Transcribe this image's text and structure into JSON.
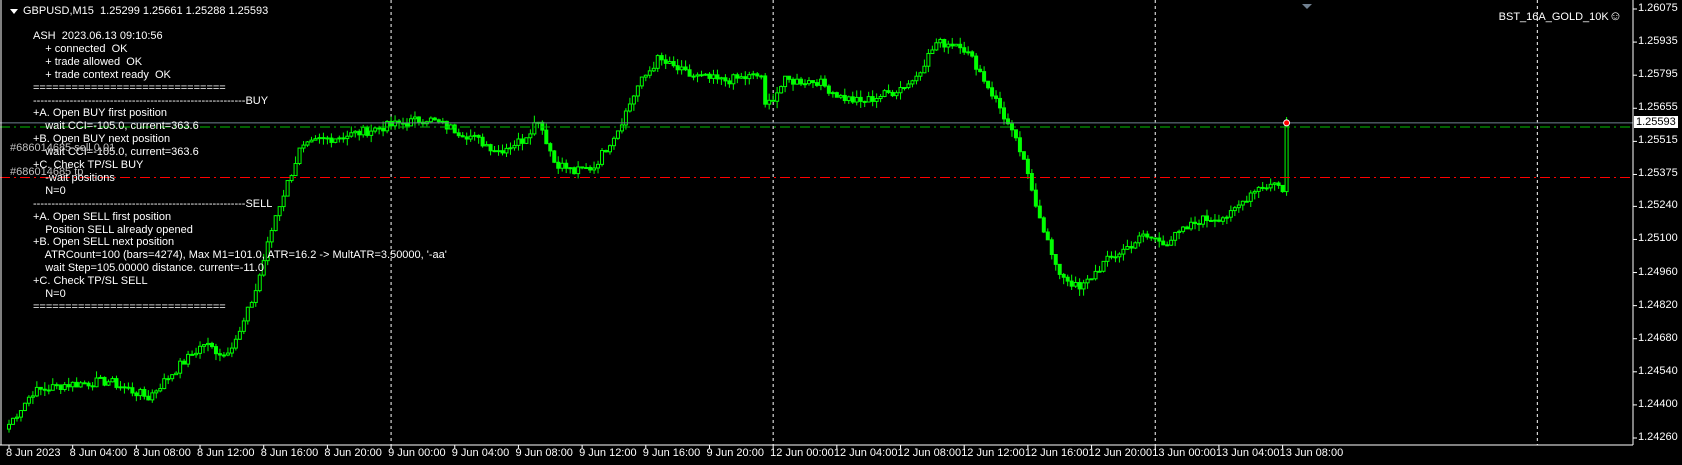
{
  "header": {
    "symbol": "GBPUSD,M15",
    "ohlc": "1.25299 1.25661 1.25288 1.25593"
  },
  "expert": {
    "name": "BST_16A_GOLD_10K",
    "icon": "smiley-icon"
  },
  "info_lines": [
    "ASH  2023.06.13 09:10:56",
    "    + connected  OK",
    "    + trade allowed  OK",
    "    + trade context ready  OK",
    "==============================",
    "----------------------------------------------------------BUY",
    "+A. Open BUY first position",
    "    wait CCI=-105.0, current=363.6",
    "+B. Open BUY next position",
    "    wait CCI=-105.0, current=363.6",
    "+C. Check TP/SL BUY",
    "    -wait positions",
    "    N=0",
    "----------------------------------------------------------SELL",
    "+A. Open SELL first position",
    "    Position SELL already opened",
    "+B. Open SELL next position",
    "    ATRCount=100 (bars=4274), Max M1=101.0, ATR=16.2 -> MultATR=3.50000, '-aa'",
    "    wait Step=105.00000 distance. current=-11.0",
    "+C. Check TP/SL SELL",
    "    N=0",
    "=============================="
  ],
  "orders": {
    "open_label": "#686014685 sell 0.01",
    "open_price": 1.2558,
    "tp_label": "#686014685 tp",
    "tp_price": 1.25362
  },
  "current_price": {
    "value": 1.25593,
    "label": "1.25593"
  },
  "price_axis": {
    "labels": [
      "1.26075",
      "1.25935",
      "1.25795",
      "1.25655",
      "1.25515",
      "1.25375",
      "1.25240",
      "1.25100",
      "1.24960",
      "1.24820",
      "1.24680",
      "1.24540",
      "1.24400",
      "1.24260"
    ],
    "max": 1.26075,
    "min": 1.2426
  },
  "time_axis": {
    "labels": [
      "8 Jun 2023",
      "8 Jun 04:00",
      "8 Jun 08:00",
      "8 Jun 12:00",
      "8 Jun 16:00",
      "8 Jun 20:00",
      "9 Jun 00:00",
      "9 Jun 04:00",
      "9 Jun 08:00",
      "9 Jun 12:00",
      "9 Jun 16:00",
      "9 Jun 20:00",
      "12 Jun 00:00",
      "12 Jun 04:00",
      "12 Jun 08:00",
      "12 Jun 12:00",
      "12 Jun 16:00",
      "12 Jun 20:00",
      "13 Jun 00:00",
      "13 Jun 04:00",
      "13 Jun 08:00"
    ],
    "bars_per_label": 16
  },
  "separators_bars": [
    96,
    192,
    288,
    384
  ],
  "price_path": [
    [
      0,
      1.24318
    ],
    [
      6,
      1.24455
    ],
    [
      14,
      1.24486
    ],
    [
      25,
      1.245
    ],
    [
      35,
      1.24432
    ],
    [
      43,
      1.24568
    ],
    [
      49,
      1.24659
    ],
    [
      54,
      1.24613
    ],
    [
      58,
      1.24704
    ],
    [
      62,
      1.24886
    ],
    [
      67,
      1.25203
    ],
    [
      73,
      1.25476
    ],
    [
      78,
      1.25521
    ],
    [
      86,
      1.25544
    ],
    [
      94,
      1.25576
    ],
    [
      105,
      1.25612
    ],
    [
      115,
      1.25544
    ],
    [
      123,
      1.25476
    ],
    [
      129,
      1.25521
    ],
    [
      133,
      1.25612
    ],
    [
      137,
      1.2543
    ],
    [
      142,
      1.25385
    ],
    [
      147,
      1.25408
    ],
    [
      153,
      1.25567
    ],
    [
      158,
      1.25748
    ],
    [
      163,
      1.25862
    ],
    [
      171,
      1.25794
    ],
    [
      179,
      1.25771
    ],
    [
      189,
      1.25794
    ],
    [
      190,
      1.25657
    ],
    [
      195,
      1.25771
    ],
    [
      203,
      1.25771
    ],
    [
      209,
      1.25703
    ],
    [
      214,
      1.2568
    ],
    [
      222,
      1.25725
    ],
    [
      227,
      1.25771
    ],
    [
      233,
      1.2593
    ],
    [
      239,
      1.2593
    ],
    [
      243,
      1.25839
    ],
    [
      249,
      1.25657
    ],
    [
      254,
      1.25476
    ],
    [
      259,
      1.25203
    ],
    [
      263,
      1.24976
    ],
    [
      266,
      1.24931
    ],
    [
      269,
      1.24886
    ],
    [
      275,
      1.24999
    ],
    [
      285,
      1.25113
    ],
    [
      291,
      1.2509
    ],
    [
      299,
      1.25181
    ],
    [
      307,
      1.25203
    ],
    [
      313,
      1.25317
    ],
    [
      319,
      1.2534
    ],
    [
      320,
      1.25299
    ],
    [
      321,
      1.25593
    ]
  ],
  "colors": {
    "bg": "#000000",
    "candle": "#00ff00",
    "grid": "#ffffff",
    "bid": "#708090",
    "open_line": "#00c000",
    "tp_line": "#ff0000"
  }
}
